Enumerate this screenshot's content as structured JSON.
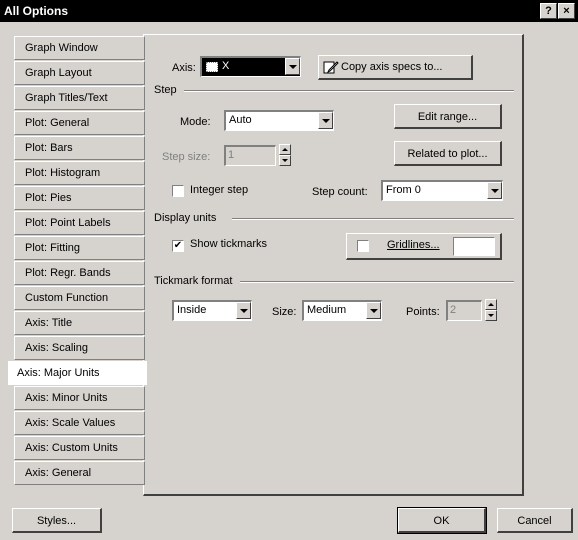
{
  "window": {
    "title": "All Options",
    "help_btn": "?",
    "close_btn": "×"
  },
  "tabs": [
    {
      "label": "Graph Window",
      "active": false
    },
    {
      "label": "Graph Layout",
      "active": false
    },
    {
      "label": "Graph Titles/Text",
      "active": false
    },
    {
      "label": "Plot: General",
      "active": false
    },
    {
      "label": "Plot: Bars",
      "active": false
    },
    {
      "label": "Plot: Histogram",
      "active": false
    },
    {
      "label": "Plot: Pies",
      "active": false
    },
    {
      "label": "Plot: Point Labels",
      "active": false
    },
    {
      "label": "Plot: Fitting",
      "active": false
    },
    {
      "label": "Plot: Regr. Bands",
      "active": false
    },
    {
      "label": "Custom Function",
      "active": false
    },
    {
      "label": "Axis: Title",
      "active": false
    },
    {
      "label": "Axis: Scaling",
      "active": false
    },
    {
      "label": "Axis: Major Units",
      "active": true
    },
    {
      "label": "Axis: Minor Units",
      "active": false
    },
    {
      "label": "Axis: Scale Values",
      "active": false
    },
    {
      "label": "Axis: Custom Units",
      "active": false
    },
    {
      "label": "Axis: General",
      "active": false
    }
  ],
  "panel": {
    "axis_label": "Axis:",
    "axis_value": "X",
    "copy_btn": "Copy axis specs to...",
    "step_group": "Step",
    "mode_label": "Mode:",
    "mode_value": "Auto",
    "edit_range_btn": "Edit range...",
    "step_size_label": "Step size:",
    "step_size_value": "1",
    "related_btn": "Related to plot...",
    "integer_step_label": "Integer step",
    "integer_step_checked": false,
    "step_count_label": "Step count:",
    "step_count_value": "From 0",
    "display_units_group": "Display units",
    "show_tickmarks_label": "Show tickmarks",
    "show_tickmarks_checked": true,
    "gridlines_checked": false,
    "gridlines_btn": "Gridlines...",
    "tickmark_format_group": "Tickmark format",
    "tick_position_value": "Inside",
    "size_label": "Size:",
    "size_value": "Medium",
    "points_label": "Points:",
    "points_value": "2"
  },
  "footer": {
    "styles_btn": "Styles...",
    "ok_btn": "OK",
    "cancel_btn": "Cancel"
  }
}
